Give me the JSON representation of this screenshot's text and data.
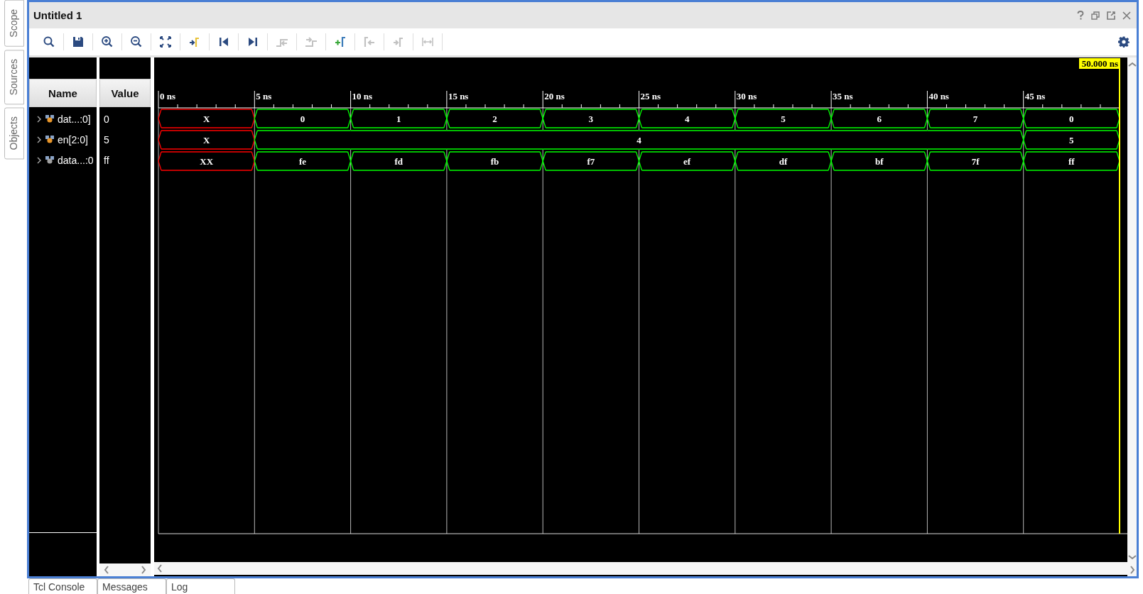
{
  "side_tabs": [
    {
      "label": "Scope",
      "selected": false
    },
    {
      "label": "Sources",
      "selected": false
    },
    {
      "label": "Objects",
      "selected": false
    }
  ],
  "window": {
    "title": "Untitled 1"
  },
  "toolbar": [
    {
      "kind": "search",
      "disabled": false
    },
    {
      "kind": "save",
      "disabled": false
    },
    {
      "kind": "zoom_in",
      "disabled": false
    },
    {
      "kind": "zoom_out",
      "disabled": false
    },
    {
      "kind": "zoom_fit",
      "disabled": false
    },
    {
      "kind": "go_to_cursor",
      "disabled": false
    },
    {
      "kind": "go_to_start",
      "disabled": false
    },
    {
      "kind": "go_to_end",
      "disabled": false
    },
    {
      "kind": "previous_transition",
      "disabled": true
    },
    {
      "kind": "next_transition",
      "disabled": true
    },
    {
      "kind": "add_marker",
      "disabled": false
    },
    {
      "kind": "previous_marker",
      "disabled": true
    },
    {
      "kind": "next_marker",
      "disabled": true
    },
    {
      "kind": "swap_cursors",
      "disabled": true
    }
  ],
  "columns": [
    "Name",
    "Value"
  ],
  "signals": [
    {
      "name": "dat...:0]",
      "value": "0",
      "expanded": false,
      "color": "#e8962a"
    },
    {
      "name": "en[2:0]",
      "value": "5",
      "expanded": false,
      "color": "#e8962a"
    },
    {
      "name": "data...:0",
      "value": "ff",
      "expanded": false,
      "color": "#a0a0a0"
    }
  ],
  "waveform": {
    "cursor": {
      "label": "50.000 ns"
    },
    "time_ticks": [
      "0 ns",
      "5 ns",
      "10 ns",
      "15 ns",
      "20 ns",
      "25 ns",
      "30 ns",
      "35 ns",
      "40 ns",
      "45 ns"
    ],
    "rows": [
      {
        "slots": [
          {
            "transition": true,
            "label": "X",
            "color": "#ff0000"
          },
          {
            "transition": true,
            "label": "0",
            "color": "#00ff00"
          },
          {
            "transition": true,
            "label": "1",
            "color": "#00ff00"
          },
          {
            "transition": true,
            "label": "2",
            "color": "#00ff00"
          },
          {
            "transition": true,
            "label": "3",
            "color": "#00ff00"
          },
          {
            "transition": true,
            "label": "4",
            "color": "#00ff00"
          },
          {
            "transition": true,
            "label": "5",
            "color": "#00ff00"
          },
          {
            "transition": true,
            "label": "6",
            "color": "#00ff00"
          },
          {
            "transition": true,
            "label": "7",
            "color": "#00ff00"
          },
          {
            "transition": true,
            "label": "0",
            "color": "#00ff00"
          }
        ]
      },
      {
        "slots": [
          {
            "transition": true,
            "label": "X",
            "color": "#ff0000"
          },
          {
            "transition": true,
            "label": "4",
            "color": "#00ff00"
          },
          {
            "transition": false
          },
          {
            "transition": false
          },
          {
            "transition": false
          },
          {
            "transition": false
          },
          {
            "transition": false
          },
          {
            "transition": false
          },
          {
            "transition": false
          },
          {
            "transition": true,
            "label": "5",
            "color": "#00ff00"
          }
        ]
      },
      {
        "slots": [
          {
            "transition": true,
            "label": "XX",
            "color": "#ff0000"
          },
          {
            "transition": true,
            "label": "fe",
            "color": "#00ff00"
          },
          {
            "transition": true,
            "label": "fd",
            "color": "#00ff00"
          },
          {
            "transition": true,
            "label": "fb",
            "color": "#00ff00"
          },
          {
            "transition": true,
            "label": "f7",
            "color": "#00ff00"
          },
          {
            "transition": true,
            "label": "ef",
            "color": "#00ff00"
          },
          {
            "transition": true,
            "label": "df",
            "color": "#00ff00"
          },
          {
            "transition": true,
            "label": "bf",
            "color": "#00ff00"
          },
          {
            "transition": true,
            "label": "7f",
            "color": "#00ff00"
          },
          {
            "transition": true,
            "label": "ff",
            "color": "#00ff00"
          }
        ]
      }
    ]
  },
  "bottom_tabs": [
    {
      "label": "Tcl Console",
      "selected": false
    },
    {
      "label": "Messages",
      "selected": false
    },
    {
      "label": "Log",
      "selected": false
    }
  ]
}
